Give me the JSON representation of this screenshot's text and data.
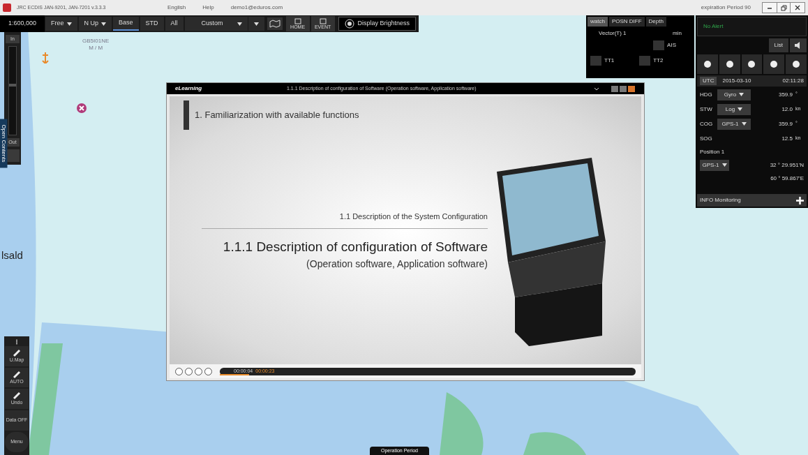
{
  "window": {
    "title": "JRC ECDIS JAN-9201, JAN-7201 v.3.3.3",
    "menu": [
      "English",
      "Help",
      "demo1@eduros.com"
    ],
    "expiration": "expiration Period 90"
  },
  "toolbar": {
    "scale": "1:600,000",
    "buttons": [
      {
        "label": "Free",
        "dropdown": true,
        "selected": false
      },
      {
        "label": "N Up",
        "dropdown": true,
        "selected": false
      },
      {
        "label": "Base",
        "dropdown": false,
        "selected": true
      },
      {
        "label": "STD",
        "dropdown": false,
        "selected": false
      },
      {
        "label": "All",
        "dropdown": false,
        "selected": false
      },
      {
        "label": "Custom",
        "dropdown": true,
        "selected": false
      }
    ],
    "icon_labels": [
      "HOME",
      "EVENT"
    ],
    "brightness": "Display Brightness"
  },
  "map": {
    "labels": [
      "GB5I01NE",
      "M / M",
      "lsald"
    ]
  },
  "watch_panel": {
    "tabs": [
      {
        "label": "watch",
        "selected": true
      },
      {
        "label": "POSN DIFF",
        "selected": false
      },
      {
        "label": "Depth",
        "selected": false
      }
    ],
    "vector": "Vector(T) 1",
    "unit": "min",
    "targets": [
      "AIS",
      "TT1",
      "TT2"
    ]
  },
  "alert": {
    "text": "No Alert",
    "list": "List"
  },
  "nav": {
    "utc": [
      "UTC",
      "2015-03-10",
      "02:11:28"
    ],
    "rows": [
      {
        "label": "HDG",
        "source": "Gyro",
        "value": "359.9",
        "unit": "°"
      },
      {
        "label": "STW",
        "source": "Log",
        "value": "12.0",
        "unit": "kn"
      },
      {
        "label": "COG",
        "source": "GPS-1",
        "value": "359.9",
        "unit": "°"
      },
      {
        "label": "SOG",
        "source": "",
        "value": "12.5",
        "unit": "kn"
      }
    ],
    "position_label": "Position 1",
    "position_source": "GPS-1",
    "lat": "32 ° 29.951'N",
    "lon": "60 ° 59.867'E",
    "info": "INFO Monitoring"
  },
  "zoom": {
    "in": "In",
    "out": "Out",
    "level": 0.55,
    "contents": "Open Contents"
  },
  "left_tools": [
    "U.Map",
    "AUTO",
    "Undo",
    "Data OFF",
    "Menu"
  ],
  "player": {
    "brand": "eLearning",
    "title": "1.1.1 Description of configuration of Software (Operation software, Application software)",
    "heading": "1. Familiarization with available functions",
    "section": "1.1 Description of the System Configuration",
    "main": "1.1.1 Description of configuration of Software",
    "sub": "(Operation software, Application software)",
    "elapsed": "00:00:04",
    "total": "00:00:23",
    "level": 0.07
  },
  "footer": "Operation Period"
}
